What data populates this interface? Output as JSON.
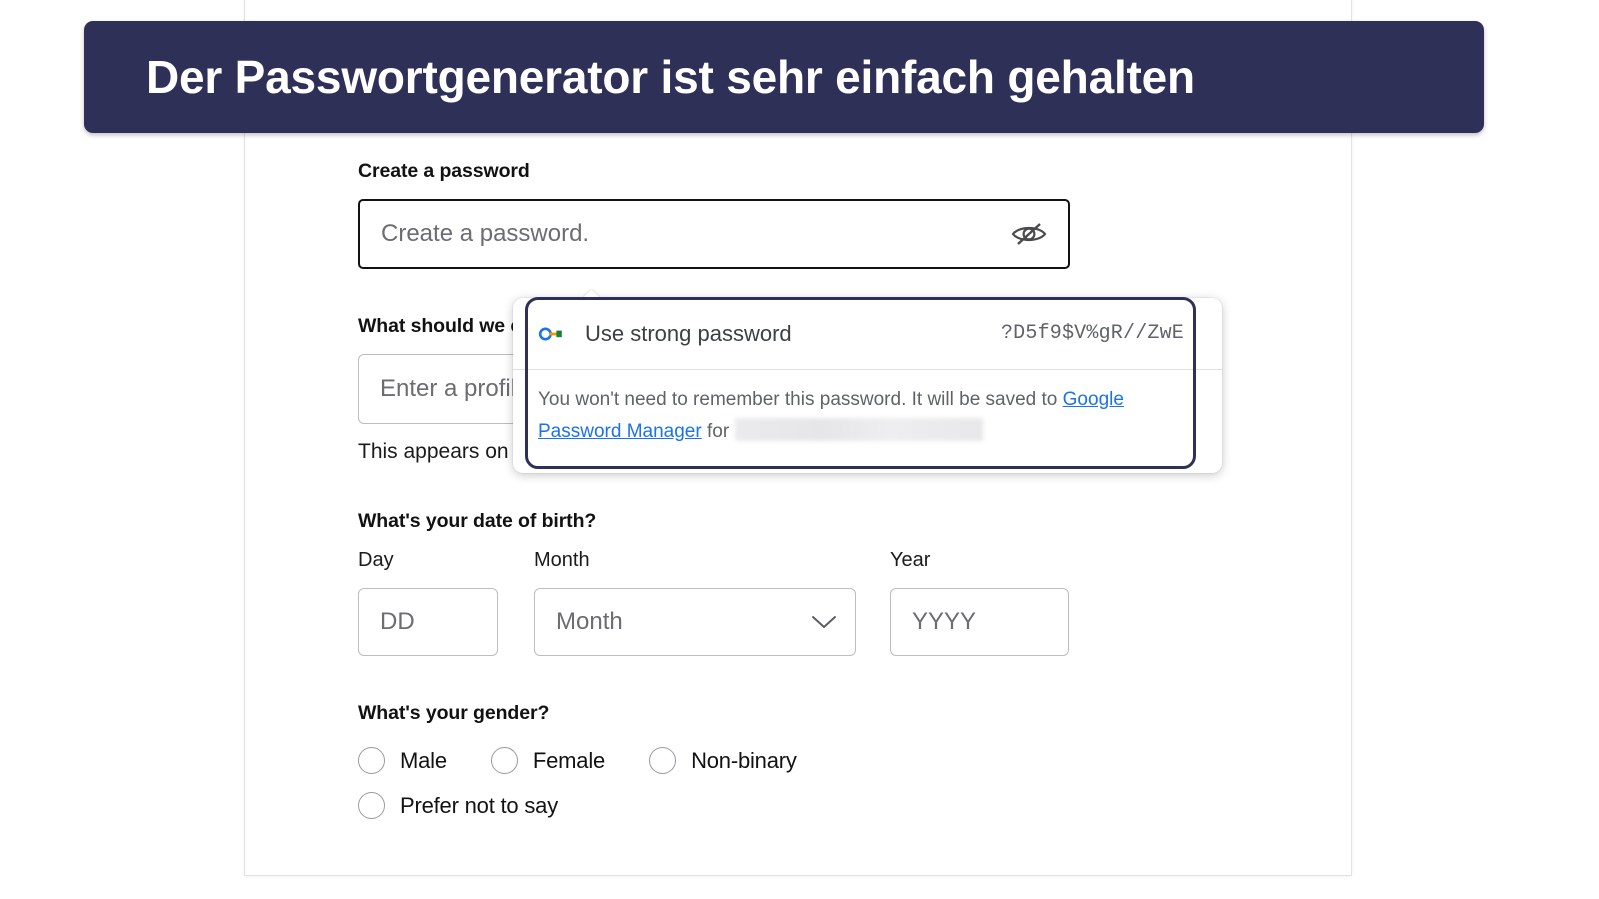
{
  "annotation": {
    "text": "Der Passwortgenerator ist sehr einfach gehalten",
    "bg_color": "#2e3058",
    "text_color": "#ffffff"
  },
  "form": {
    "password": {
      "label": "Create a password",
      "placeholder": "Create a password.",
      "value": "",
      "toggle_icon": "eye-slash-icon"
    },
    "profile_name": {
      "label": "What should we call you?",
      "placeholder": "Enter a profile name.",
      "value": "",
      "help_text": "This appears on your profile."
    },
    "date_of_birth": {
      "label": "What's your date of birth?",
      "day": {
        "label": "Day",
        "placeholder": "DD",
        "value": ""
      },
      "month": {
        "label": "Month",
        "placeholder": "Month",
        "value": "",
        "chevron": "chevron-down-icon"
      },
      "year": {
        "label": "Year",
        "placeholder": "YYYY",
        "value": ""
      }
    },
    "gender": {
      "label": "What's your gender?",
      "options": [
        {
          "label": "Male",
          "selected": false
        },
        {
          "label": "Female",
          "selected": false
        },
        {
          "label": "Non-binary",
          "selected": false
        },
        {
          "label": "Prefer not to say",
          "selected": false
        }
      ]
    }
  },
  "password_suggestion_popup": {
    "icon": "google-password-key-icon",
    "action_label": "Use strong password",
    "suggested_password": "?D5f9$V%gR//ZwE",
    "note_prefix": "You won't need to remember this password. It will be saved to ",
    "note_link": "Google Password Manager",
    "note_suffix": " for",
    "redacted_account": "",
    "focus_ring_color": "#2e3058",
    "link_color": "#1a73e8"
  }
}
